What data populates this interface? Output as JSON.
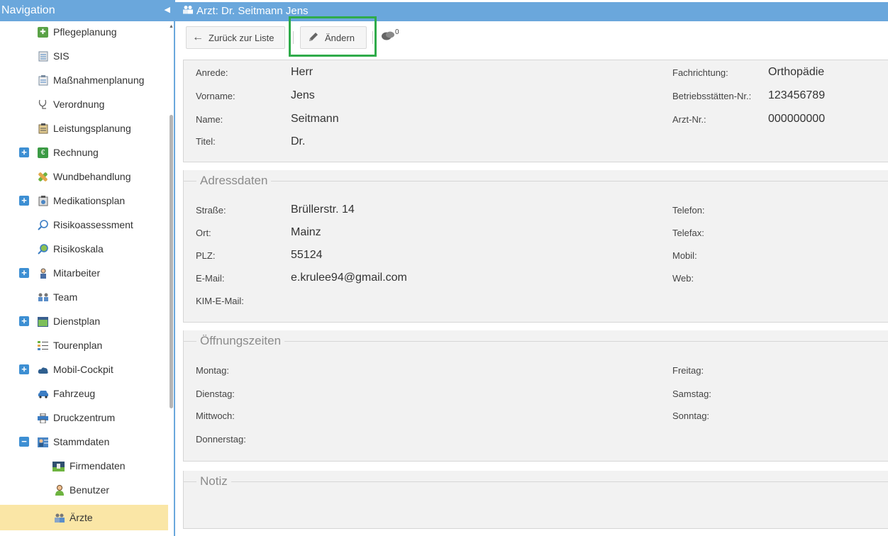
{
  "nav": {
    "title": "Navigation",
    "items": [
      {
        "label": "Pflegeplanung",
        "icon": "care-planning-icon"
      },
      {
        "label": "SIS",
        "icon": "document-icon"
      },
      {
        "label": "Maßnahmenplanung",
        "icon": "measures-icon"
      },
      {
        "label": "Verordnung",
        "icon": "stethoscope-icon"
      },
      {
        "label": "Leistungsplanung",
        "icon": "clipboard-icon"
      },
      {
        "label": "Rechnung",
        "icon": "invoice-icon"
      },
      {
        "label": "Wundbehandlung",
        "icon": "bandage-icon"
      },
      {
        "label": "Medikationsplan",
        "icon": "medication-icon"
      },
      {
        "label": "Risikoassessment",
        "icon": "magnifier-icon"
      },
      {
        "label": "Risikoskala",
        "icon": "magnifier-scale-icon"
      },
      {
        "label": "Mitarbeiter",
        "icon": "employee-icon"
      },
      {
        "label": "Team",
        "icon": "team-icon"
      },
      {
        "label": "Dienstplan",
        "icon": "schedule-icon"
      },
      {
        "label": "Tourenplan",
        "icon": "route-icon"
      },
      {
        "label": "Mobil-Cockpit",
        "icon": "cloud-icon"
      },
      {
        "label": "Fahrzeug",
        "icon": "car-icon"
      },
      {
        "label": "Druckzentrum",
        "icon": "printer-icon"
      },
      {
        "label": "Stammdaten",
        "icon": "master-data-icon"
      },
      {
        "label": "Firmendaten",
        "icon": "company-icon"
      },
      {
        "label": "Benutzer",
        "icon": "user-icon"
      },
      {
        "label": "Ärzte",
        "icon": "doctors-icon"
      }
    ],
    "expand_symbol": "+",
    "collapse_symbol": "−"
  },
  "title": "Arzt: Dr. Seitmann Jens",
  "toolbar": {
    "back_label": "Zurück zur Liste",
    "edit_label": "Ändern",
    "comment_count": "0"
  },
  "person": {
    "anrede_label": "Anrede:",
    "anrede": "Herr",
    "vorname_label": "Vorname:",
    "vorname": "Jens",
    "name_label": "Name:",
    "name": "Seitmann",
    "titel_label": "Titel:",
    "titel": "Dr.",
    "fachrichtung_label": "Fachrichtung:",
    "fachrichtung": "Orthopädie",
    "bsnr_label": "Betriebsstätten-Nr.:",
    "bsnr": "123456789",
    "arztnr_label": "Arzt-Nr.:",
    "arztnr": "000000000"
  },
  "address": {
    "legend": "Adressdaten",
    "strasse_label": "Straße:",
    "strasse": "Brüllerstr. 14",
    "ort_label": "Ort:",
    "ort": "Mainz",
    "plz_label": "PLZ:",
    "plz": "55124",
    "email_label": "E-Mail:",
    "email": "e.krulee94@gmail.com",
    "kim_label": "KIM-E-Mail:",
    "telefon_label": "Telefon:",
    "telefax_label": "Telefax:",
    "mobil_label": "Mobil:",
    "web_label": "Web:"
  },
  "hours": {
    "legend": "Öffnungszeiten",
    "montag": "Montag:",
    "dienstag": "Dienstag:",
    "mittwoch": "Mittwoch:",
    "donnerstag": "Donnerstag:",
    "freitag": "Freitag:",
    "samstag": "Samstag:",
    "sonntag": "Sonntag:"
  },
  "notes": {
    "legend": "Notiz"
  },
  "colors": {
    "header": "#6aa7dc",
    "active_nav": "#fae6a6",
    "highlight": "#2fab4a",
    "panel": "#f2f2f2"
  }
}
